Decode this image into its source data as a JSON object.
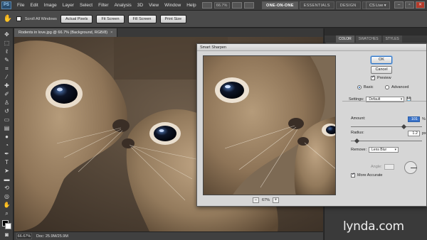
{
  "app": {
    "logo": "PS"
  },
  "menu": {
    "items": [
      "File",
      "Edit",
      "Image",
      "Layer",
      "Select",
      "Filter",
      "Analysis",
      "3D",
      "View",
      "Window",
      "Help"
    ],
    "zoom": "66.7%"
  },
  "workspaces": {
    "items": [
      "ONE-ON-ONE",
      "ESSENTIALS",
      "DESIGN",
      "»"
    ]
  },
  "cs_live": "CS Live ▾",
  "window_buttons": {
    "minimize": "–",
    "restore": "▫",
    "close": "✕"
  },
  "options_bar": {
    "tool_icon": "hand-icon",
    "scroll_all_label": "Scroll All Windows",
    "actual_pixels": "Actual Pixels",
    "fit_screen": "Fit Screen",
    "fill_screen": "Fill Screen",
    "print_size": "Print Size"
  },
  "document": {
    "tab_label": "Rodents in love.jpg @ 66.7% (Background, RGB/8)",
    "tab_close": "×",
    "zoom": "66.67%",
    "doc_info": "Doc: 25.9M/25.9M"
  },
  "panels": {
    "tabs": [
      "COLOR",
      "SWATCHES",
      "STYLES"
    ]
  },
  "dialog": {
    "title": "Smart Sharpen",
    "ok": "OK",
    "cancel": "Cancel",
    "preview_label": "Preview",
    "basic_label": "Basic",
    "advanced_label": "Advanced",
    "settings_label": "Settings:",
    "settings_value": "Default",
    "amount_label": "Amount:",
    "amount_value": "101",
    "amount_unit": "%",
    "radius_label": "Radius:",
    "radius_value": "1.2",
    "radius_unit": "px",
    "remove_label": "Remove:",
    "remove_value": "Lens Blur",
    "angle_label": "Angle:",
    "more_accurate_label": "More Accurate",
    "preview_zoom": "67%",
    "zoom_out": "–",
    "zoom_in": "+"
  },
  "watermark": "lynda.com"
}
